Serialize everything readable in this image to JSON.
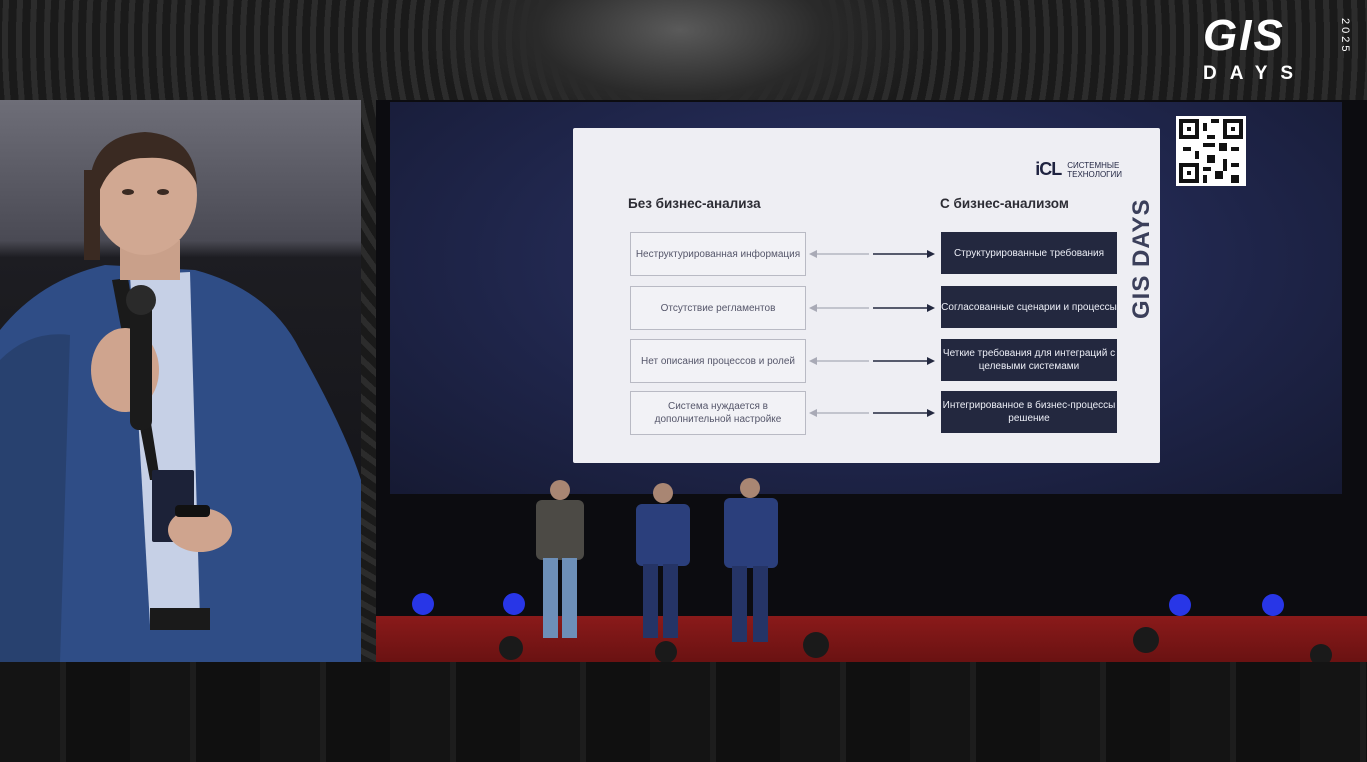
{
  "logo": {
    "gis": "GIS",
    "days": "DAYS",
    "year": "2025"
  },
  "slide": {
    "brand_mark": "iCL",
    "brand_name_line1": "СИСТЕМНЫЕ",
    "brand_name_line2": "ТЕХНОЛОГИИ",
    "side_logo": "GIS DAYS",
    "left_heading": "Без бизнес-анализа",
    "right_heading": "С бизнес-анализом",
    "rows": [
      {
        "left": "Неструктурированная информация",
        "right": "Структурированные требования"
      },
      {
        "left": "Отсутствие регламентов",
        "right": "Согласованные сценарии и процессы"
      },
      {
        "left": "Нет описания процессов и ролей",
        "right": "Четкие требования для интеграций с целевыми системами"
      },
      {
        "left": "Система нуждается в дополнительной настройке",
        "right": "Интегрированное в бизнес-процессы решение"
      }
    ]
  },
  "colors": {
    "slide_dark": "#23283f",
    "screen_blue": "#1e2448",
    "stage_red": "#8a1a1a",
    "stage_light": "#2b3bff"
  }
}
